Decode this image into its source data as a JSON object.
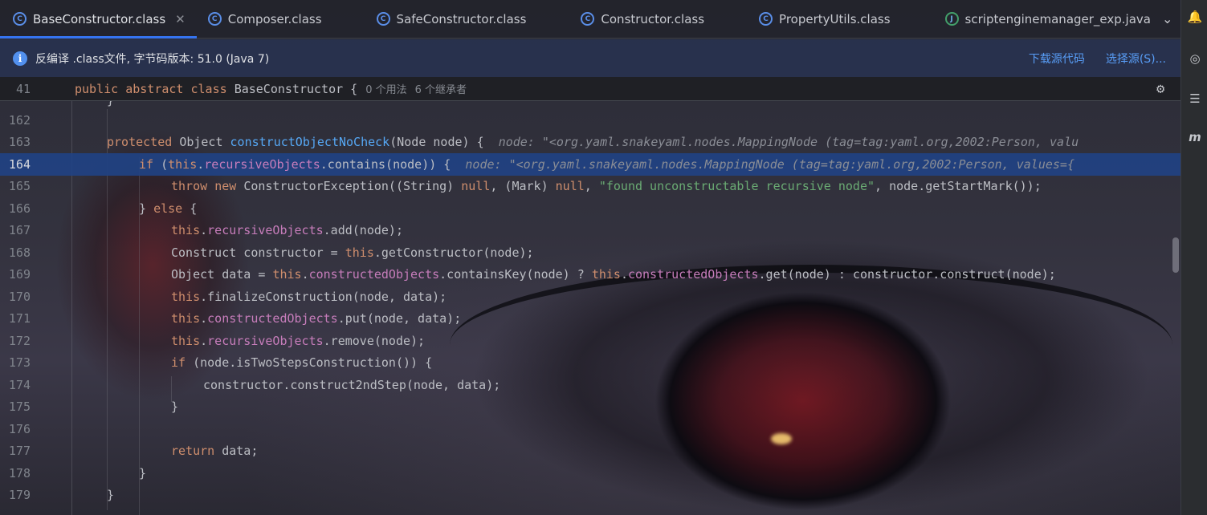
{
  "tabs": [
    {
      "label": "BaseConstructor.class",
      "icon": "class-file-icon",
      "active": true,
      "closable": true
    },
    {
      "label": "Composer.class",
      "icon": "class-file-icon"
    },
    {
      "label": "SafeConstructor.class",
      "icon": "class-file-icon"
    },
    {
      "label": "Constructor.class",
      "icon": "class-file-icon"
    },
    {
      "label": "PropertyUtils.class",
      "icon": "class-file-icon"
    },
    {
      "label": "scriptenginemanager_exp.java",
      "icon": "java-file-icon"
    }
  ],
  "tab_controls": {
    "dropdown": "⌄",
    "more": "⋮"
  },
  "banner": {
    "text": "反编译 .class文件, 字节码版本: 51.0 (Java 7)",
    "download_source": "下载源代码",
    "choose_source": "选择源(S)..."
  },
  "sticky_header": {
    "line_number": "41",
    "code_public": "public",
    "code_abstract": "abstract",
    "code_class": "class",
    "code_name": "BaseConstructor {",
    "usages": "0 个用法",
    "inheritors": "6 个继承者"
  },
  "editor": {
    "partial_top_line": "}",
    "lines": [
      {
        "n": "162"
      },
      {
        "n": "163",
        "kw": "protected",
        "type": "Object",
        "method": "constructObjectNoCheck",
        "params": "(Node node) {",
        "hint": "node: \"<org.yaml.snakeyaml.nodes.MappingNode (tag=tag:yaml.org,2002:Person, valu"
      },
      {
        "n": "164",
        "if_kw": "if",
        "open": "(",
        "this": "this",
        "field": "recursiveObjects",
        "rest": ".contains(node)) {",
        "hint": "node: \"<org.yaml.snakeyaml.nodes.MappingNode (tag=tag:yaml.org,2002:Person, values={"
      },
      {
        "n": "165",
        "throw": "throw",
        "new": "new",
        "call": "ConstructorException((String) ",
        "null1": "null",
        "mid": ", (Mark) ",
        "null2": "null",
        "comma": ", ",
        "str": "\"found unconstructable recursive node\"",
        "end": ", node.getStartMark());"
      },
      {
        "n": "166",
        "close": "} ",
        "else": "else",
        "open": " {"
      },
      {
        "n": "167",
        "this": "this",
        "dot": ".",
        "field": "recursiveObjects",
        "rest": ".add(node);"
      },
      {
        "n": "168",
        "pre": "Construct constructor = ",
        "this": "this",
        "rest": ".getConstructor(node);"
      },
      {
        "n": "169",
        "pre": "Object data = ",
        "this1": "this",
        "dot1": ".",
        "field1": "constructedObjects",
        "mid": ".containsKey(node) ? ",
        "this2": "this",
        "dot2": ".",
        "field2": "constructedObjects",
        "rest": ".get(node) : constructor.construct(node);"
      },
      {
        "n": "170",
        "this": "this",
        "rest": ".finalizeConstruction(node, data);"
      },
      {
        "n": "171",
        "this": "this",
        "dot": ".",
        "field": "constructedObjects",
        "rest": ".put(node, data);"
      },
      {
        "n": "172",
        "this": "this",
        "dot": ".",
        "field": "recursiveObjects",
        "rest": ".remove(node);"
      },
      {
        "n": "173",
        "if_kw": "if",
        "rest": " (node.isTwoStepsConstruction()) {"
      },
      {
        "n": "174",
        "text": "constructor.construct2ndStep(node, data);"
      },
      {
        "n": "175",
        "text": "}"
      },
      {
        "n": "176"
      },
      {
        "n": "177",
        "ret": "return",
        "rest": " data;"
      },
      {
        "n": "178",
        "text": "}"
      },
      {
        "n": "179",
        "text": "}"
      }
    ]
  },
  "colors": {
    "accent": "#3574f0",
    "keyword": "#cf8e6d",
    "method": "#56a8f5",
    "field": "#c77dbb",
    "string": "#6aab73",
    "highlight": "#214283"
  }
}
